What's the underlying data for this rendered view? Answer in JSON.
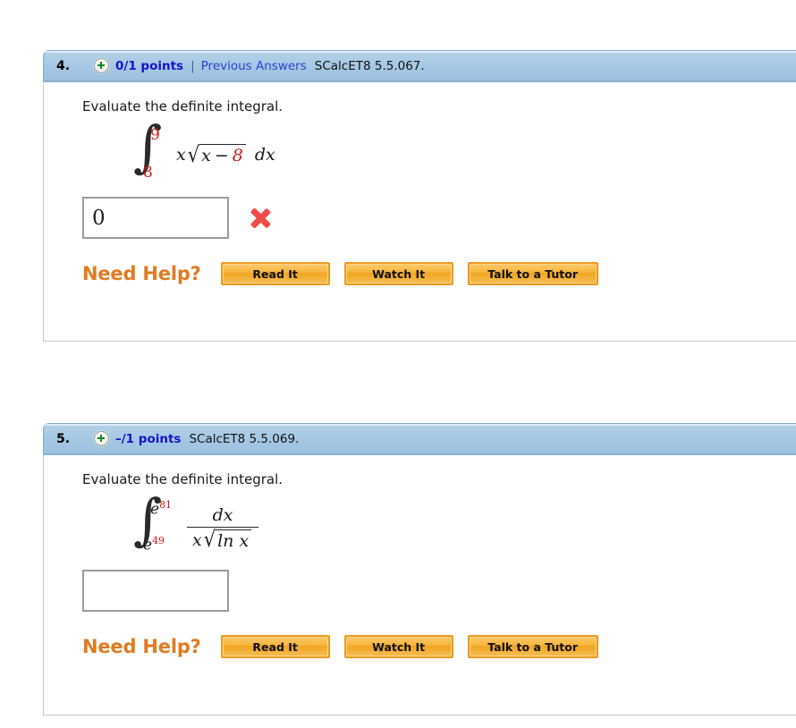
{
  "problems": [
    {
      "number": "4.",
      "status_icon": "plus-circle-icon",
      "points": "0/1 points",
      "separator": "|",
      "previous_answers": "Previous Answers",
      "reference": "SCalcET8 5.5.067.",
      "prompt": "Evaluate the definite integral.",
      "integral": {
        "upper_limit": "9",
        "lower_limit": "8",
        "integrand_prefix": "x",
        "radicand_x": "x",
        "radicand_minus": "−",
        "radicand_const": "8",
        "differential": "dx"
      },
      "answer_value": "0",
      "answer_placeholder": "",
      "grade_icon": "red-x-icon",
      "need_help_label": "Need Help?",
      "buttons": [
        "Read It",
        "Watch It",
        "Talk to a Tutor"
      ]
    },
    {
      "number": "5.",
      "status_icon": "plus-circle-icon",
      "points": "–/1 points",
      "reference": "SCalcET8 5.5.069.",
      "prompt": "Evaluate the definite integral.",
      "integral": {
        "upper_base": "e",
        "upper_exp": "81",
        "lower_base": "e",
        "lower_exp": "49",
        "numerator": "dx",
        "den_x": "x",
        "den_radicand": "ln x"
      },
      "answer_value": "",
      "answer_placeholder": "",
      "need_help_label": "Need Help?",
      "buttons": [
        "Read It",
        "Watch It",
        "Talk to a Tutor"
      ]
    }
  ],
  "colors": {
    "header_blue": "#a5c7e3",
    "points_blue": "#1712c9",
    "link_blue": "#2a43d0",
    "math_red": "#d01818",
    "orange": "#e07b22",
    "x_red": "#ef4b4b"
  }
}
